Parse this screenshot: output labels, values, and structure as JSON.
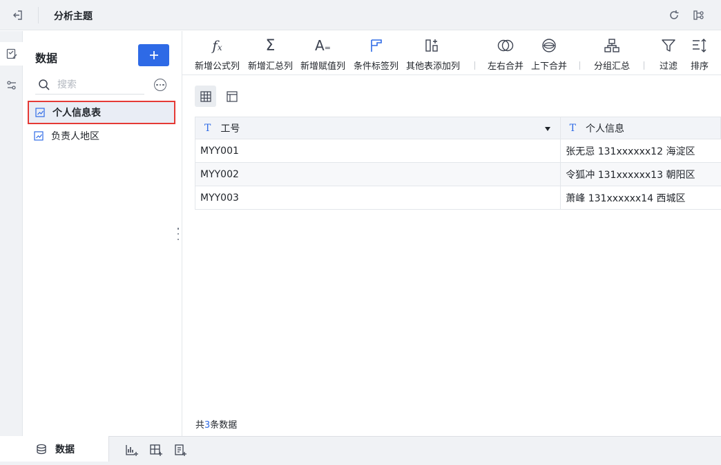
{
  "topbar": {
    "title": "分析主题"
  },
  "icons": {
    "back": "exit-icon",
    "refresh": "refresh-icon",
    "flow": "flow-icon",
    "rail_data": "data-edit-icon",
    "rail_filter": "filter-settings-icon",
    "add": "plus-icon",
    "search": "search-icon",
    "more": "more-icon",
    "table": "table-chart-icon"
  },
  "datapanel": {
    "title": "数据",
    "search_placeholder": "搜索",
    "tables": [
      {
        "label": "个人信息表",
        "selected": true
      },
      {
        "label": "负责人地区",
        "selected": false
      }
    ]
  },
  "toolbar": {
    "tools": [
      {
        "label": "新增公式列",
        "icon": "formula-icon"
      },
      {
        "label": "新增汇总列",
        "icon": "sigma-icon"
      },
      {
        "label": "新增赋值列",
        "icon": "assign-icon"
      },
      {
        "label": "条件标签列",
        "icon": "flag-icon"
      },
      {
        "label": "其他表添加列",
        "icon": "add-column-icon"
      },
      {
        "label": "左右合并",
        "icon": "merge-horizontal-icon"
      },
      {
        "label": "上下合并",
        "icon": "merge-vertical-icon"
      },
      {
        "label": "分组汇总",
        "icon": "group-icon"
      },
      {
        "label": "过滤",
        "icon": "filter-icon"
      },
      {
        "label": "排序",
        "icon": "sort-icon"
      }
    ]
  },
  "views": {
    "grid": "grid-view-icon",
    "layout": "layout-view-icon"
  },
  "table": {
    "columns": [
      {
        "type": "T",
        "label": "工号"
      },
      {
        "type": "T",
        "label": "个人信息"
      }
    ],
    "rows": [
      [
        "MYY001",
        "张无忌 131xxxxxx12 海淀区"
      ],
      [
        "MYY002",
        "令狐冲 131xxxxxx13 朝阳区"
      ],
      [
        "MYY003",
        "萧峰 131xxxxxx14 西城区"
      ]
    ]
  },
  "footer": {
    "prefix": "共",
    "count": "3",
    "suffix": "条数据"
  },
  "bottombar": {
    "tab_label": "数据"
  },
  "colors": {
    "accent": "#2e6ae6",
    "highlight": "#e53935"
  }
}
